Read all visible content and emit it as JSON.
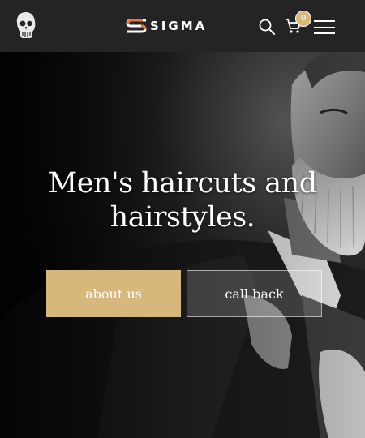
{
  "header": {
    "brand": "SIGMA",
    "cart_count": "0",
    "icons": [
      "skull-logo-icon",
      "brand-mark-icon",
      "search-icon",
      "cart-icon",
      "menu-icon"
    ]
  },
  "hero": {
    "title": "Men's haircuts and hairstyles.",
    "about_label": "about us",
    "call_label": "call back"
  },
  "colors": {
    "header_bg": "#242424",
    "accent": "#d7b77b",
    "text": "#ffffff"
  }
}
